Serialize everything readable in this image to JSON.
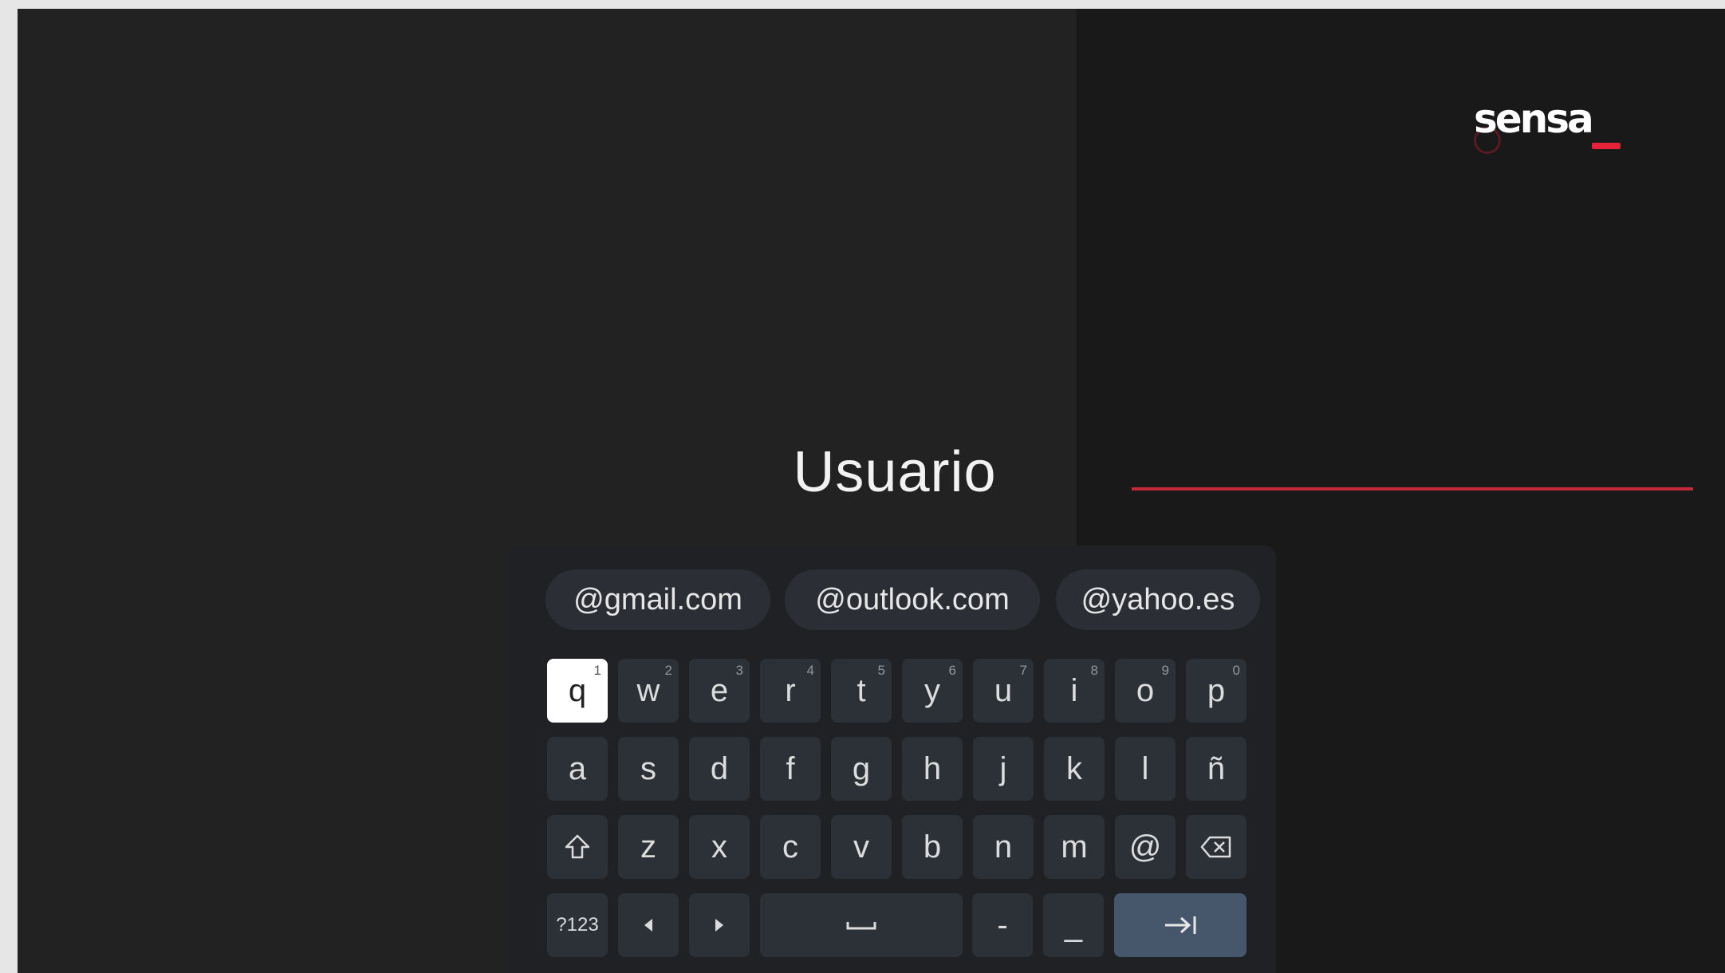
{
  "brand": {
    "logo_text": "sensa",
    "accent": "#e5213a"
  },
  "field": {
    "label": "Usuario",
    "value": ""
  },
  "suggestions": [
    "@gmail.com",
    "@outlook.com",
    "@yahoo.es"
  ],
  "keyboard": {
    "row1": [
      {
        "label": "q",
        "hint": "1"
      },
      {
        "label": "w",
        "hint": "2"
      },
      {
        "label": "e",
        "hint": "3"
      },
      {
        "label": "r",
        "hint": "4"
      },
      {
        "label": "t",
        "hint": "5"
      },
      {
        "label": "y",
        "hint": "6"
      },
      {
        "label": "u",
        "hint": "7"
      },
      {
        "label": "i",
        "hint": "8"
      },
      {
        "label": "o",
        "hint": "9"
      },
      {
        "label": "p",
        "hint": "0"
      }
    ],
    "row2": [
      "a",
      "s",
      "d",
      "f",
      "g",
      "h",
      "j",
      "k",
      "l",
      "ñ"
    ],
    "row3": [
      "z",
      "x",
      "c",
      "v",
      "b",
      "n",
      "m",
      "@"
    ],
    "row4": {
      "symbols": "?123",
      "dash": "-",
      "underscore": "_"
    },
    "focused_key": "q",
    "icons": {
      "shift": "shift-icon",
      "backspace": "backspace-icon",
      "left": "arrow-left-icon",
      "right": "arrow-right-icon",
      "space": "space-icon",
      "next": "tab-next-icon"
    }
  }
}
